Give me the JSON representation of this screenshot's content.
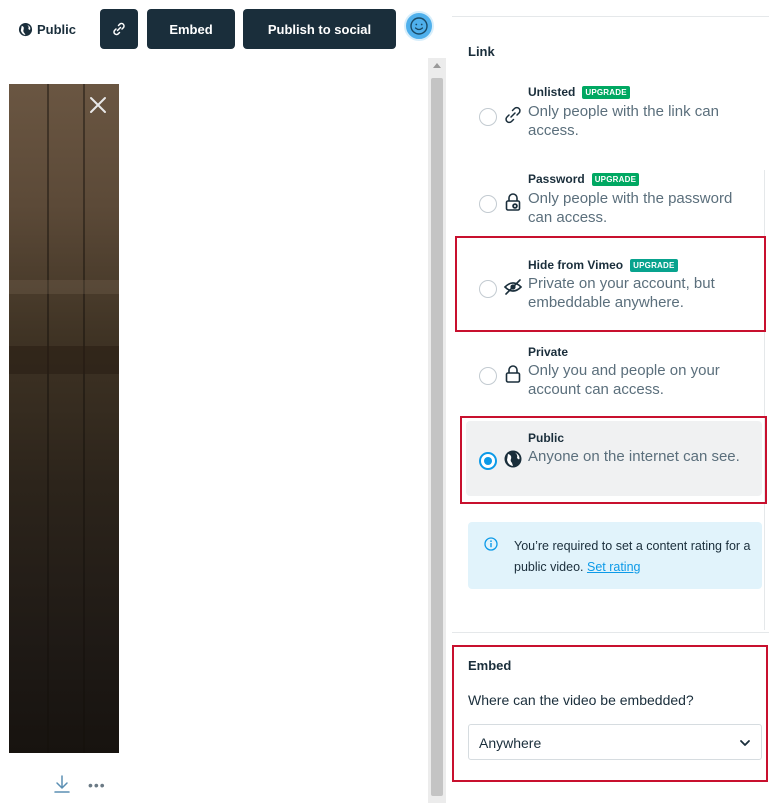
{
  "toolbar": {
    "privacy_label": "Public",
    "embed_label": "Embed",
    "publish_label": "Publish to social",
    "icons": {
      "privacy": "globe-icon",
      "link": "link-icon",
      "avatar": "smiley-face-icon"
    }
  },
  "preview": {
    "icons": {
      "close": "close-icon",
      "download": "download-icon",
      "more": "more-dots-icon"
    }
  },
  "panel": {
    "link_heading": "Link",
    "options": [
      {
        "id": "unlisted",
        "title": "Unlisted",
        "badge": "UPGRADE",
        "desc": "Only people with the link can access.",
        "icon": "link-icon",
        "selected": false
      },
      {
        "id": "password",
        "title": "Password",
        "badge": "UPGRADE",
        "desc": "Only people with the password can access.",
        "icon": "lock-key-icon",
        "selected": false
      },
      {
        "id": "hide",
        "title": "Hide from Vimeo",
        "badge": "UPGRADE",
        "desc": "Private on your account, but embeddable anywhere.",
        "icon": "eye-off-icon",
        "selected": false
      },
      {
        "id": "private",
        "title": "Private",
        "desc": "Only you and people on your account can access.",
        "icon": "lock-icon",
        "selected": false
      },
      {
        "id": "public",
        "title": "Public",
        "desc": "Anyone on the internet can see.",
        "icon": "globe-icon",
        "selected": true
      }
    ],
    "info": {
      "text": "You’re required to set a content rating for a public video.",
      "link": "Set rating",
      "icon": "info-icon"
    },
    "embed_heading": "Embed",
    "embed_question": "Where can the video be embedded?",
    "embed_select_value": "Anywhere",
    "icons": {
      "chevron": "chevron-down-icon"
    }
  },
  "colors": {
    "primary_dark": "#1a2e3b",
    "accent_blue": "#0c9ae8",
    "upgrade_green": "#00a862",
    "highlight_red": "#c8102e",
    "info_bg": "#e1f3fb"
  }
}
